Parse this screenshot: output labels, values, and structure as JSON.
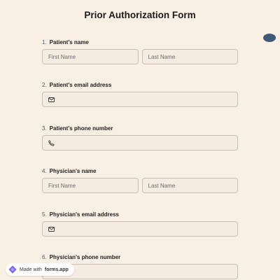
{
  "form": {
    "title": "Prior Authorization Form"
  },
  "questions": [
    {
      "number": "1.",
      "label": "Patient's name",
      "first_placeholder": "First Name",
      "last_placeholder": "Last Name"
    },
    {
      "number": "2.",
      "label": "Patient's email address",
      "icon": "email-icon"
    },
    {
      "number": "3.",
      "label": "Patient's phone number",
      "icon": "phone-icon"
    },
    {
      "number": "4.",
      "label": "Physician's name",
      "first_placeholder": "First Name",
      "last_placeholder": "Last Name"
    },
    {
      "number": "5.",
      "label": "Physician's email address",
      "icon": "email-icon"
    },
    {
      "number": "6.",
      "label": "Physician's phone number",
      "icon": "phone-icon"
    }
  ],
  "badge": {
    "prefix": "Made with",
    "brand": "forms.app"
  },
  "colors": {
    "background": "#faefe4",
    "field_background": "#f6ebe1",
    "field_border": "#c8bdb3",
    "nav_dot": "#3e5a78",
    "brand_purple": "#6b5cf6"
  }
}
